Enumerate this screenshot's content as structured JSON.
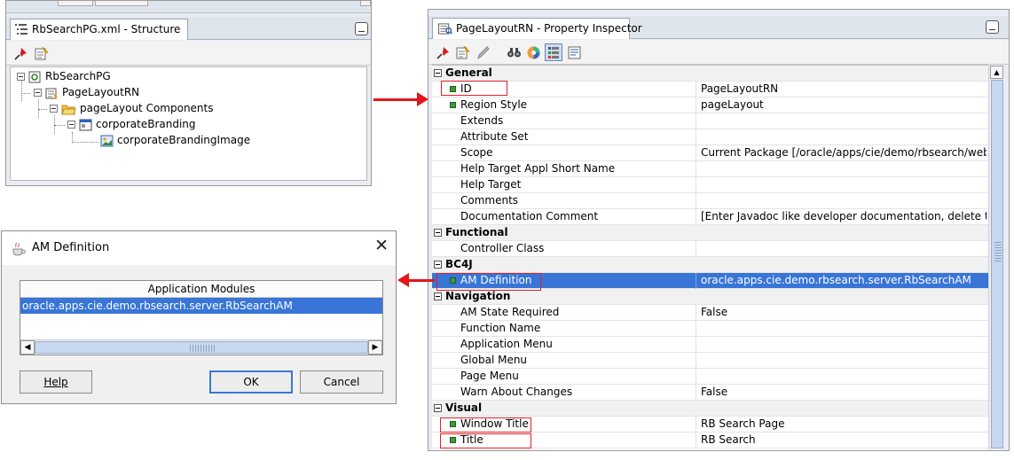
{
  "structure_panel": {
    "tab_title": "RbSearchPG.xml - Structure",
    "tree": [
      {
        "label": "RbSearchPG",
        "icon": "page-icon"
      },
      {
        "label": "PageLayoutRN",
        "icon": "region-icon"
      },
      {
        "label": "pageLayout Components",
        "icon": "folder-icon"
      },
      {
        "label": "corporateBranding",
        "icon": "branding-icon"
      },
      {
        "label": "corporateBrandingImage",
        "icon": "image-icon"
      }
    ]
  },
  "am_dialog": {
    "title": "AM Definition",
    "close_glyph": "✕",
    "list_header": "Application Modules",
    "selected_item": "oracle.apps.cie.demo.rbsearch.server.RbSearchAM",
    "buttons": {
      "help": "Help",
      "ok": "OK",
      "cancel": "Cancel"
    }
  },
  "property_inspector": {
    "tab_title": "PageLayoutRN - Property Inspector",
    "sections": {
      "general": "General",
      "functional": "Functional",
      "bc4j": "BC4J",
      "navigation": "Navigation",
      "visual": "Visual"
    },
    "rows": {
      "id": {
        "name": "ID",
        "value": "PageLayoutRN"
      },
      "region_style": {
        "name": "Region Style",
        "value": "pageLayout"
      },
      "extends": {
        "name": "Extends",
        "value": ""
      },
      "attribute_set": {
        "name": "Attribute Set",
        "value": ""
      },
      "scope": {
        "name": "Scope",
        "value": "Current Package [/oracle/apps/cie/demo/rbsearch/webui]"
      },
      "help_target_appl": {
        "name": "Help Target Appl Short Name",
        "value": ""
      },
      "help_target": {
        "name": "Help Target",
        "value": ""
      },
      "comments": {
        "name": "Comments",
        "value": ""
      },
      "doc_comment": {
        "name": "Documentation Comment",
        "value": "[Enter Javadoc like developer documentation, delete thi..."
      },
      "controller_class": {
        "name": "Controller Class",
        "value": ""
      },
      "am_definition": {
        "name": "AM Definition",
        "value": "oracle.apps.cie.demo.rbsearch.server.RbSearchAM"
      },
      "am_state_required": {
        "name": "AM State Required",
        "value": "False"
      },
      "function_name": {
        "name": "Function Name",
        "value": ""
      },
      "application_menu": {
        "name": "Application Menu",
        "value": ""
      },
      "global_menu": {
        "name": "Global Menu",
        "value": ""
      },
      "page_menu": {
        "name": "Page Menu",
        "value": ""
      },
      "warn_about_changes": {
        "name": "Warn About Changes",
        "value": "False"
      },
      "window_title": {
        "name": "Window Title",
        "value": "RB Search Page"
      },
      "title": {
        "name": "Title",
        "value": "RB Search"
      }
    }
  },
  "colors": {
    "selection": "#3875d7",
    "highlight_box": "#e0202a",
    "arrow": "#e3151b",
    "property_set_marker": "#3a9b3a"
  }
}
